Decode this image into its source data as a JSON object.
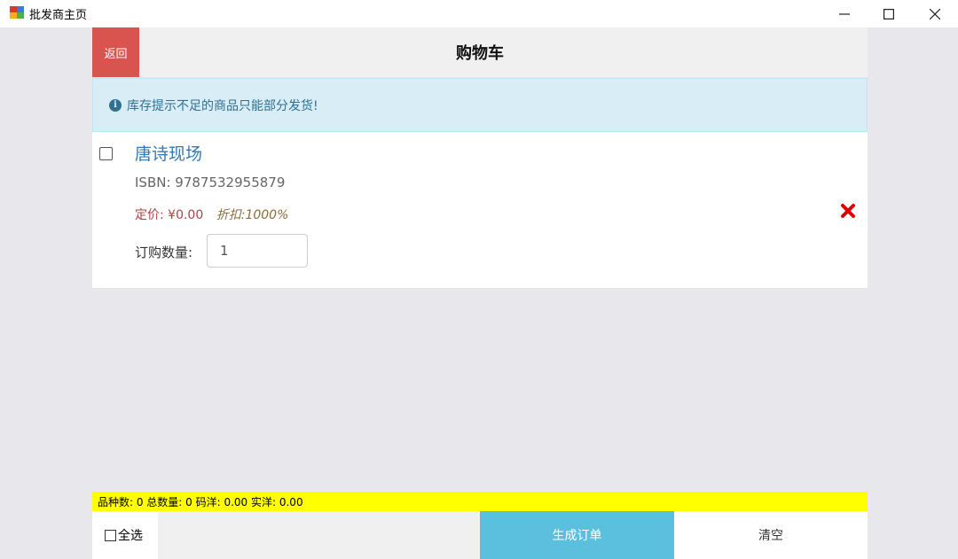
{
  "window": {
    "title": "批发商主页",
    "minimize_symbol": "—",
    "maximize_symbol": "☐",
    "close_symbol": "✕"
  },
  "header": {
    "back_label": "返回",
    "title": "购物车"
  },
  "alert": {
    "icon": "info-icon",
    "icon_glyph": "i",
    "text": "库存提示不足的商品只能部分发货!"
  },
  "cart": {
    "items": [
      {
        "title": "唐诗现场",
        "isbn_label": "ISBN:",
        "isbn": "9787532955879",
        "price_label": "定价:",
        "price": "¥0.00",
        "discount_label": "折扣:",
        "discount": "1000%",
        "qty_label": "订购数量:",
        "quantity": "1",
        "checked": false
      }
    ]
  },
  "summary": {
    "text": "品种数: 0 总数量: 0 码洋: 0.00 实洋: 0.00"
  },
  "footer": {
    "select_all_label": "全选",
    "generate_label": "生成订单",
    "clear_label": "清空"
  },
  "colors": {
    "back_button": "#d9534f",
    "generate_button": "#5bc0de",
    "summary_bar": "#ffff00",
    "alert_bg": "#d9edf7",
    "remove_icon": "#e00000"
  }
}
